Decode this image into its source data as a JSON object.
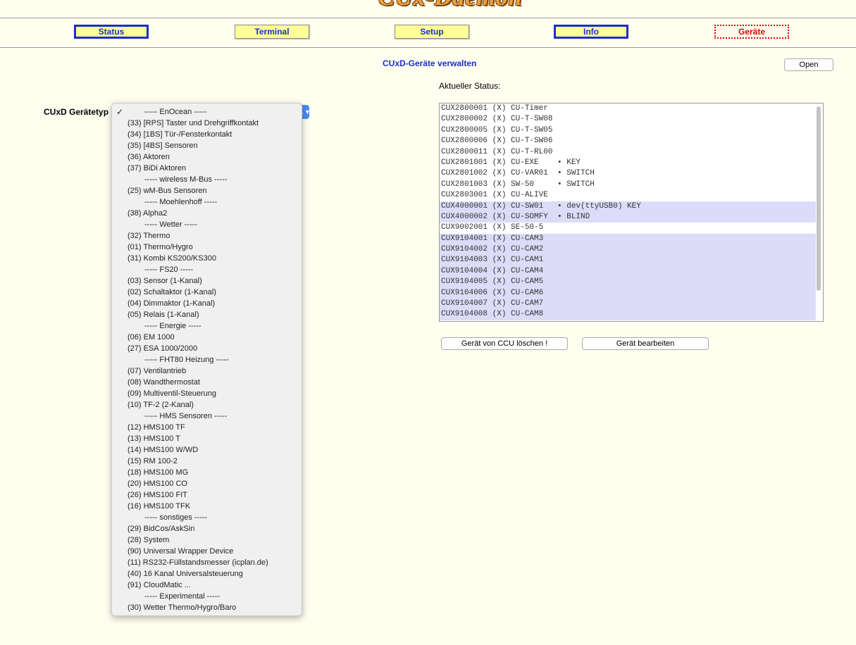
{
  "header": {
    "logo_text": "CUx-Daemon"
  },
  "nav": [
    {
      "label": "Status"
    },
    {
      "label": "Terminal"
    },
    {
      "label": "Setup"
    },
    {
      "label": "Info"
    },
    {
      "label": "Geräte"
    }
  ],
  "page": {
    "title": "CUxD-Geräte verwalten",
    "open_button": "Open",
    "device_type_label": "CUxD Gerätetyp",
    "status_label": "Aktueller Status:",
    "delete_button": "Gerät von CCU löschen !",
    "edit_button": "Gerät bearbeiten"
  },
  "status_list": [
    {
      "text": "CUX2800001 (X) CU-Timer",
      "selected": false
    },
    {
      "text": "CUX2800002 (X) CU-T-SW08",
      "selected": false
    },
    {
      "text": "CUX2800005 (X) CU-T-SW05",
      "selected": false
    },
    {
      "text": "CUX2800006 (X) CU-T-SW06",
      "selected": false
    },
    {
      "text": "CUX2800011 (X) CU-T-RL00",
      "selected": false
    },
    {
      "text": "CUX2801001 (X) CU-EXE    • KEY",
      "selected": false
    },
    {
      "text": "CUX2801002 (X) CU-VAR01  • SWITCH",
      "selected": false
    },
    {
      "text": "CUX2801003 (X) SW-50     • SWITCH",
      "selected": false
    },
    {
      "text": "CUX2803001 (X) CU-ALIVE",
      "selected": false
    },
    {
      "text": "CUX4000001 (X) CU-SW01   • dev(ttyUSB0) KEY",
      "selected": true
    },
    {
      "text": "CUX4000002 (X) CU-SOMFY  • BLIND",
      "selected": true
    },
    {
      "text": "CUX9002001 (X) SE-50-5",
      "selected": false
    },
    {
      "text": "CUX9104001 (X) CU-CAM3",
      "selected": true
    },
    {
      "text": "CUX9104002 (X) CU-CAM2",
      "selected": true
    },
    {
      "text": "CUX9104003 (X) CU-CAM1",
      "selected": true
    },
    {
      "text": "CUX9104004 (X) CU-CAM4",
      "selected": true
    },
    {
      "text": "CUX9104005 (X) CU-CAM5",
      "selected": true
    },
    {
      "text": "CUX9104006 (X) CU-CAM6",
      "selected": true
    },
    {
      "text": "CUX9104007 (X) CU-CAM7",
      "selected": true
    },
    {
      "text": "CUX9104008 (X) CU-CAM8",
      "selected": true
    }
  ],
  "dropdown": {
    "selected_index": 0,
    "options": [
      {
        "label": "----- EnOcean -----",
        "header": true
      },
      {
        "label": "(33) [RPS] Taster und Drehgriffkontakt"
      },
      {
        "label": "(34) [1BS] Tür-/Fensterkontakt"
      },
      {
        "label": "(35) [4BS] Sensoren"
      },
      {
        "label": "(36) Aktoren"
      },
      {
        "label": "(37) BiDi Aktoren"
      },
      {
        "label": "----- wireless M-Bus -----",
        "header": true
      },
      {
        "label": "(25) wM-Bus Sensoren"
      },
      {
        "label": "----- Moehlenhoff -----",
        "header": true
      },
      {
        "label": "(38) Alpha2"
      },
      {
        "label": "----- Wetter -----",
        "header": true
      },
      {
        "label": "(32) Thermo"
      },
      {
        "label": "(01) Thermo/Hygro"
      },
      {
        "label": "(31) Kombi KS200/KS300"
      },
      {
        "label": "----- FS20 -----",
        "header": true
      },
      {
        "label": "(03) Sensor (1-Kanal)"
      },
      {
        "label": "(02) Schaltaktor (1-Kanal)"
      },
      {
        "label": "(04) Dimmaktor (1-Kanal)"
      },
      {
        "label": "(05) Relais (1-Kanal)"
      },
      {
        "label": "----- Energie -----",
        "header": true
      },
      {
        "label": "(06) EM 1000"
      },
      {
        "label": "(27) ESA 1000/2000"
      },
      {
        "label": "----- FHT80 Heizung -----",
        "header": true
      },
      {
        "label": "(07) Ventilantrieb"
      },
      {
        "label": "(08) Wandthermostat"
      },
      {
        "label": "(09) Multiventil-Steuerung"
      },
      {
        "label": "(10) TF-2 (2-Kanal)"
      },
      {
        "label": "----- HMS Sensoren -----",
        "header": true
      },
      {
        "label": "(12) HMS100 TF"
      },
      {
        "label": "(13) HMS100 T"
      },
      {
        "label": "(14) HMS100 W/WD"
      },
      {
        "label": "(15) RM 100-2"
      },
      {
        "label": "(18) HMS100 MG"
      },
      {
        "label": "(20) HMS100 CO"
      },
      {
        "label": "(26) HMS100 FIT"
      },
      {
        "label": "(16) HMS100 TFK"
      },
      {
        "label": "----- sonstiges -----",
        "header": true
      },
      {
        "label": "(29) BidCos/AskSin"
      },
      {
        "label": "(28) System"
      },
      {
        "label": "(90) Universal Wrapper Device"
      },
      {
        "label": "(11) RS232-Füllstandsmesser (icplan.de)"
      },
      {
        "label": "(40) 16 Kanal Universalsteuerung"
      },
      {
        "label": "(91) CloudMatic ..."
      },
      {
        "label": "----- Experimental -----",
        "header": true
      },
      {
        "label": "(30) Wetter Thermo/Hygro/Baro"
      }
    ]
  },
  "colors": {
    "background": "#fffff0",
    "nav_fill": "#ffff99",
    "nav_active_border": "#1a2ecc",
    "nav_current": "#e00000",
    "title": "#1a2ecc",
    "selection": "#dcdcf8"
  }
}
